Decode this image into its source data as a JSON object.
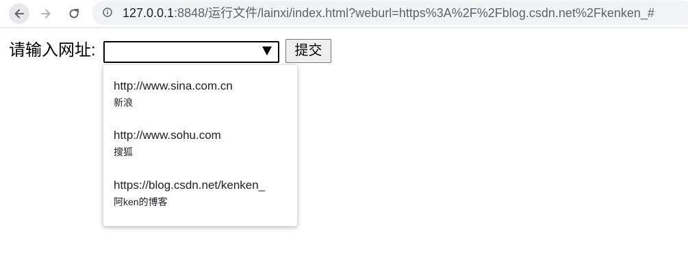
{
  "browser": {
    "url_host": "127.0.0.1",
    "url_rest": ":8848/运行文件/lainxi/index.html?weburl=https%3A%2F%2Fblog.csdn.net%2Fkenken_#"
  },
  "form": {
    "label": "请输入网址:",
    "input_value": "",
    "submit_label": "提交"
  },
  "suggestions": [
    {
      "url": "http://www.sina.com.cn",
      "label": "新浪"
    },
    {
      "url": "http://www.sohu.com",
      "label": "搜狐"
    },
    {
      "url": "https://blog.csdn.net/kenken_",
      "label": "阿ken的博客"
    }
  ]
}
